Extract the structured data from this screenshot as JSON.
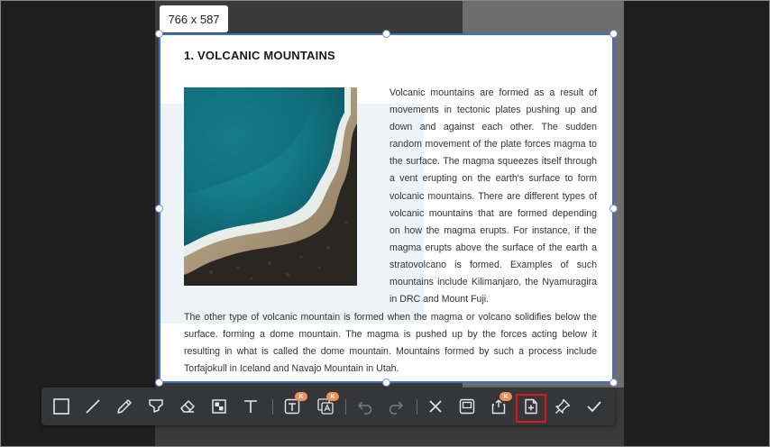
{
  "canvas": {
    "size_label": "766 x 587"
  },
  "document": {
    "title": "1. VOLCANIC MOUNTAINS",
    "side_paragraph": "Volcanic mountains are formed as a result of movements in tectonic plates pushing up and down and against each other. The sudden random movement of the plate forces magma to the surface. The magma squeezes itself through a vent erupting on the earth's surface to form volcanic mountains. There are different types of volcanic mountains that are formed depending on how the magma erupts. For instance, if the magma erupts above the surface of the earth a stratovolcano is formed. Examples of such mountains include Kilimanjaro, the Nyamuragira in DRC and Mount Fuji.",
    "bottom_paragraph": "The other type of volcanic mountain is formed when the magma or volcano solidifies below the surface. forming a dome mountain. The magma is pushed up by the forces acting below it resulting in what is called the dome mountain. Mountains formed by such a process include Torfajokull in Iceland and Navajo Mountain in Utah.",
    "image_icon": "landscape-photo"
  },
  "toolbar": {
    "tools": [
      {
        "id": "rectangle",
        "icon": "square-icon"
      },
      {
        "id": "line",
        "icon": "line-icon"
      },
      {
        "id": "pencil",
        "icon": "pencil-icon"
      },
      {
        "id": "highlighter",
        "icon": "highlighter-icon"
      },
      {
        "id": "eraser",
        "icon": "eraser-icon"
      },
      {
        "id": "mosaic",
        "icon": "mosaic-icon"
      },
      {
        "id": "text",
        "icon": "text-icon"
      },
      {
        "id": "ocr-text",
        "icon": "text-box-icon",
        "badge": "K"
      },
      {
        "id": "translate",
        "icon": "translate-icon",
        "badge": "K"
      },
      {
        "id": "undo",
        "icon": "undo-icon"
      },
      {
        "id": "redo",
        "icon": "redo-icon"
      },
      {
        "id": "close",
        "icon": "close-icon"
      },
      {
        "id": "save",
        "icon": "save-icon"
      },
      {
        "id": "export",
        "icon": "export-icon",
        "badge": "K"
      },
      {
        "id": "insert-page",
        "icon": "add-page-icon",
        "highlighted": true
      },
      {
        "id": "pin",
        "icon": "pin-icon"
      },
      {
        "id": "confirm",
        "icon": "check-icon"
      }
    ],
    "badge_color": "#f0925a",
    "highlight_color": "#e0141b"
  }
}
